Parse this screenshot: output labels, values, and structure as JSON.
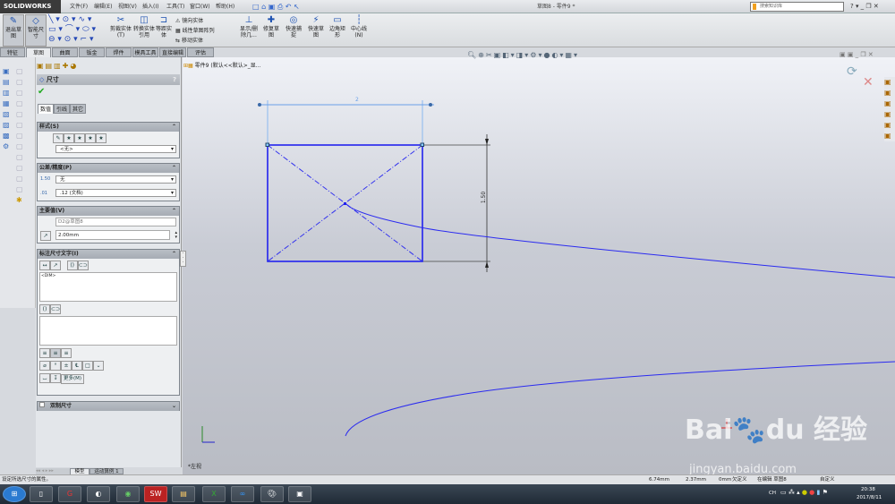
{
  "app": {
    "logo": "SOLIDWORKS",
    "doc_title": "草图8 - 零件9 *",
    "search_placeholder": "搜索知识库"
  },
  "menu": [
    "文件(F)",
    "编辑(E)",
    "视图(V)",
    "插入(I)",
    "工具(T)",
    "窗口(W)",
    "帮助(H)"
  ],
  "ribbon": {
    "exit_sketch": "退出草图",
    "smart_dim": "智能尺寸",
    "trim": "剪裁实体(T)",
    "convert": "转换实体引用",
    "offset": "等距实体",
    "mirror": "镜向实体",
    "linear_pattern": "线性草图阵列",
    "move": "移动实体",
    "display_delete": "显示/删除几...",
    "repair": "修复草图",
    "quick_snap": "快速捕捉",
    "rapid_sketch": "快速草图",
    "corner_rect": "边角矩形",
    "centerline": "中心线(N)"
  },
  "tabs": [
    "特征",
    "草图",
    "曲面",
    "钣金",
    "焊件",
    "模具工具",
    "直接编辑",
    "评估"
  ],
  "active_tab": "草图",
  "pm": {
    "title": "尺寸",
    "help": "?",
    "subtabs": [
      "数值",
      "引线",
      "其它"
    ],
    "style": {
      "header": "样式(S)",
      "select": "<无>"
    },
    "tolerance": {
      "header": "公差/精度(P)",
      "tol": "无",
      "precision": ".12 (文档)"
    },
    "primary": {
      "header": "主要值(V)",
      "name": "D2@草图8",
      "value": "2.00mm"
    },
    "dimtext": {
      "header": "标注尺寸文字(I)",
      "text": "<DIM>",
      "more": "更多(M)"
    },
    "dual": {
      "header": "双制尺寸"
    }
  },
  "tree": {
    "item": "零件9  (默认<<默认>_显..."
  },
  "sketch": {
    "width_dim": "2",
    "height_dim": "1.50"
  },
  "view_label": "*左视",
  "bottom_tabs": [
    "模型",
    "运动算例 1"
  ],
  "status": {
    "hint": "设定所选尺寸的属性。",
    "x": "6.74mm",
    "y": "2.37mm",
    "z": "0mm",
    "state": "欠定义",
    "editing": "在编辑 草图8",
    "units": "自定义"
  },
  "tray": {
    "lang": "CH",
    "time": "20:38",
    "date": "2017/8/11"
  },
  "watermark": "Baidu经验 jingyan.baidu.com"
}
